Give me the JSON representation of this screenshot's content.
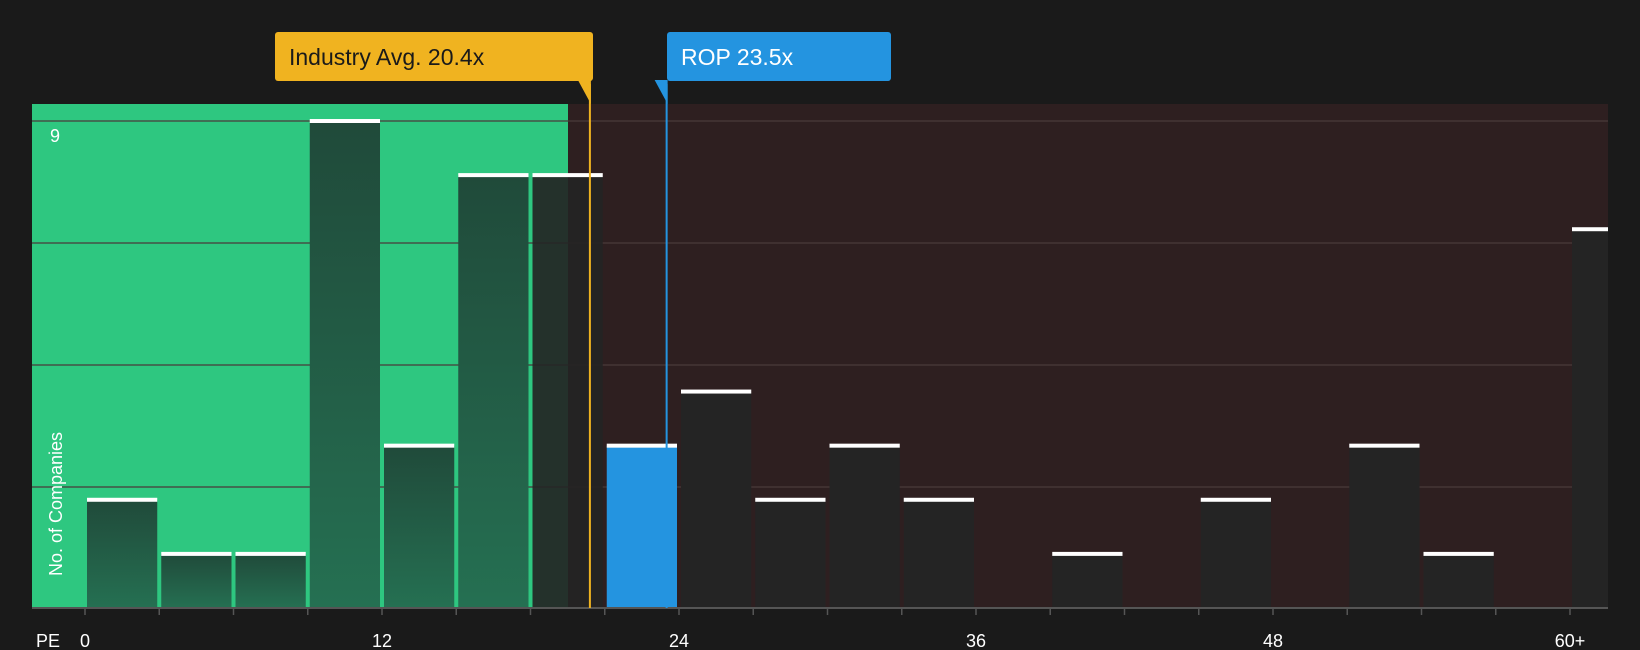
{
  "colors": {
    "background": "#1a1a1a",
    "below_zone": "#2ec780",
    "above_zone": "#2e1f20",
    "bar_default": "#242424",
    "bar_green_top": "#204a3a",
    "bar_green_bottom": "#257052",
    "bar_highlight": "#2494e0",
    "bar_cap": "#ffffff",
    "industry_marker": "#f0b320",
    "company_marker": "#2494e0",
    "gridline": "#4a3a3b",
    "axis_line": "#555555"
  },
  "chart_data": {
    "type": "bar",
    "x_axis_name": "PE",
    "ylabel": "No. of Companies",
    "y_top_label": "9",
    "ylim": [
      0,
      9
    ],
    "x_ticks": [
      {
        "value": 0,
        "label": "0"
      },
      {
        "value": 12,
        "label": "12"
      },
      {
        "value": 24,
        "label": "24"
      },
      {
        "value": 36,
        "label": "36"
      },
      {
        "value": 48,
        "label": "48"
      },
      {
        "value": 60,
        "label": "60+"
      }
    ],
    "bin_width": 3,
    "bins": [
      {
        "start": 0,
        "end": 3,
        "count": 2
      },
      {
        "start": 3,
        "end": 6,
        "count": 1
      },
      {
        "start": 6,
        "end": 9,
        "count": 1
      },
      {
        "start": 9,
        "end": 12,
        "count": 9
      },
      {
        "start": 12,
        "end": 15,
        "count": 3
      },
      {
        "start": 15,
        "end": 18,
        "count": 8
      },
      {
        "start": 18,
        "end": 21,
        "count": 8
      },
      {
        "start": 21,
        "end": 24,
        "count": 3
      },
      {
        "start": 24,
        "end": 27,
        "count": 4
      },
      {
        "start": 27,
        "end": 30,
        "count": 2
      },
      {
        "start": 30,
        "end": 33,
        "count": 3
      },
      {
        "start": 33,
        "end": 36,
        "count": 2
      },
      {
        "start": 36,
        "end": 39,
        "count": 0
      },
      {
        "start": 39,
        "end": 42,
        "count": 1
      },
      {
        "start": 42,
        "end": 45,
        "count": 0
      },
      {
        "start": 45,
        "end": 48,
        "count": 2
      },
      {
        "start": 48,
        "end": 51,
        "count": 0
      },
      {
        "start": 51,
        "end": 54,
        "count": 3
      },
      {
        "start": 54,
        "end": 57,
        "count": 1
      },
      {
        "start": 57,
        "end": 60,
        "count": 0
      },
      {
        "start": 60,
        "end": 63,
        "count": 7
      }
    ],
    "industry_avg": {
      "value": 20.4,
      "label": "Industry Avg. 20.4x"
    },
    "company": {
      "value": 23.5,
      "label": "ROP 23.5x"
    }
  }
}
